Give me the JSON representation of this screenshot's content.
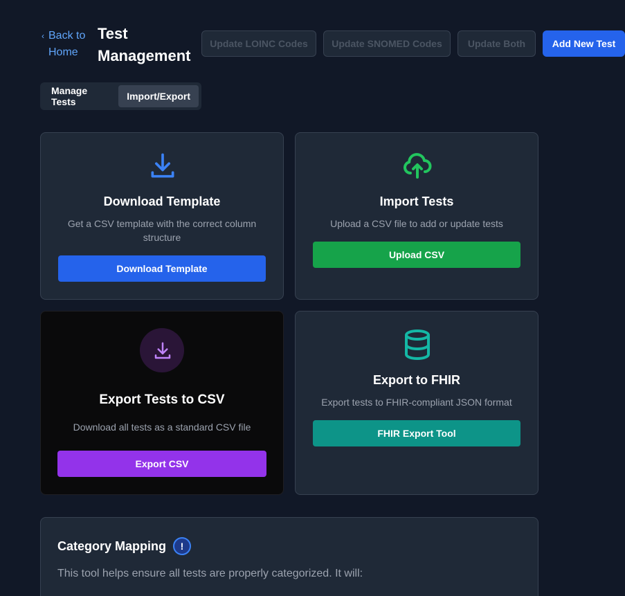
{
  "header": {
    "back_label": "Back to\nHome",
    "title": "Test\nManagement",
    "buttons": {
      "update_loinc": "Update LOINC Codes",
      "update_snomed": "Update SNOMED Codes",
      "update_both": "Update Both",
      "add_new": "Add New Test"
    }
  },
  "tabs": [
    {
      "label": "Manage Tests",
      "active": false
    },
    {
      "label": "Import/Export",
      "active": true
    }
  ],
  "cards": {
    "download_template": {
      "icon": "download-icon",
      "title": "Download Template",
      "description": "Get a CSV template with the correct column structure",
      "button": "Download Template",
      "color": "#2563eb"
    },
    "import_tests": {
      "icon": "cloud-upload-icon",
      "title": "Import Tests",
      "description": "Upload a CSV file to add or update tests",
      "button": "Upload CSV",
      "color": "#16a34a"
    },
    "export_csv": {
      "icon": "download-icon",
      "title": "Export Tests to CSV",
      "description": "Download all tests as a standard CSV file",
      "button": "Export CSV",
      "color": "#9333ea"
    },
    "export_fhir": {
      "icon": "database-icon",
      "title": "Export to FHIR",
      "description": "Export tests to FHIR-compliant JSON format",
      "button": "FHIR Export Tool",
      "color": "#0d9488"
    }
  },
  "category_mapping": {
    "title": "Category Mapping",
    "info_icon": "!",
    "description": "This tool helps ensure all tests are properly categorized. It will:"
  }
}
